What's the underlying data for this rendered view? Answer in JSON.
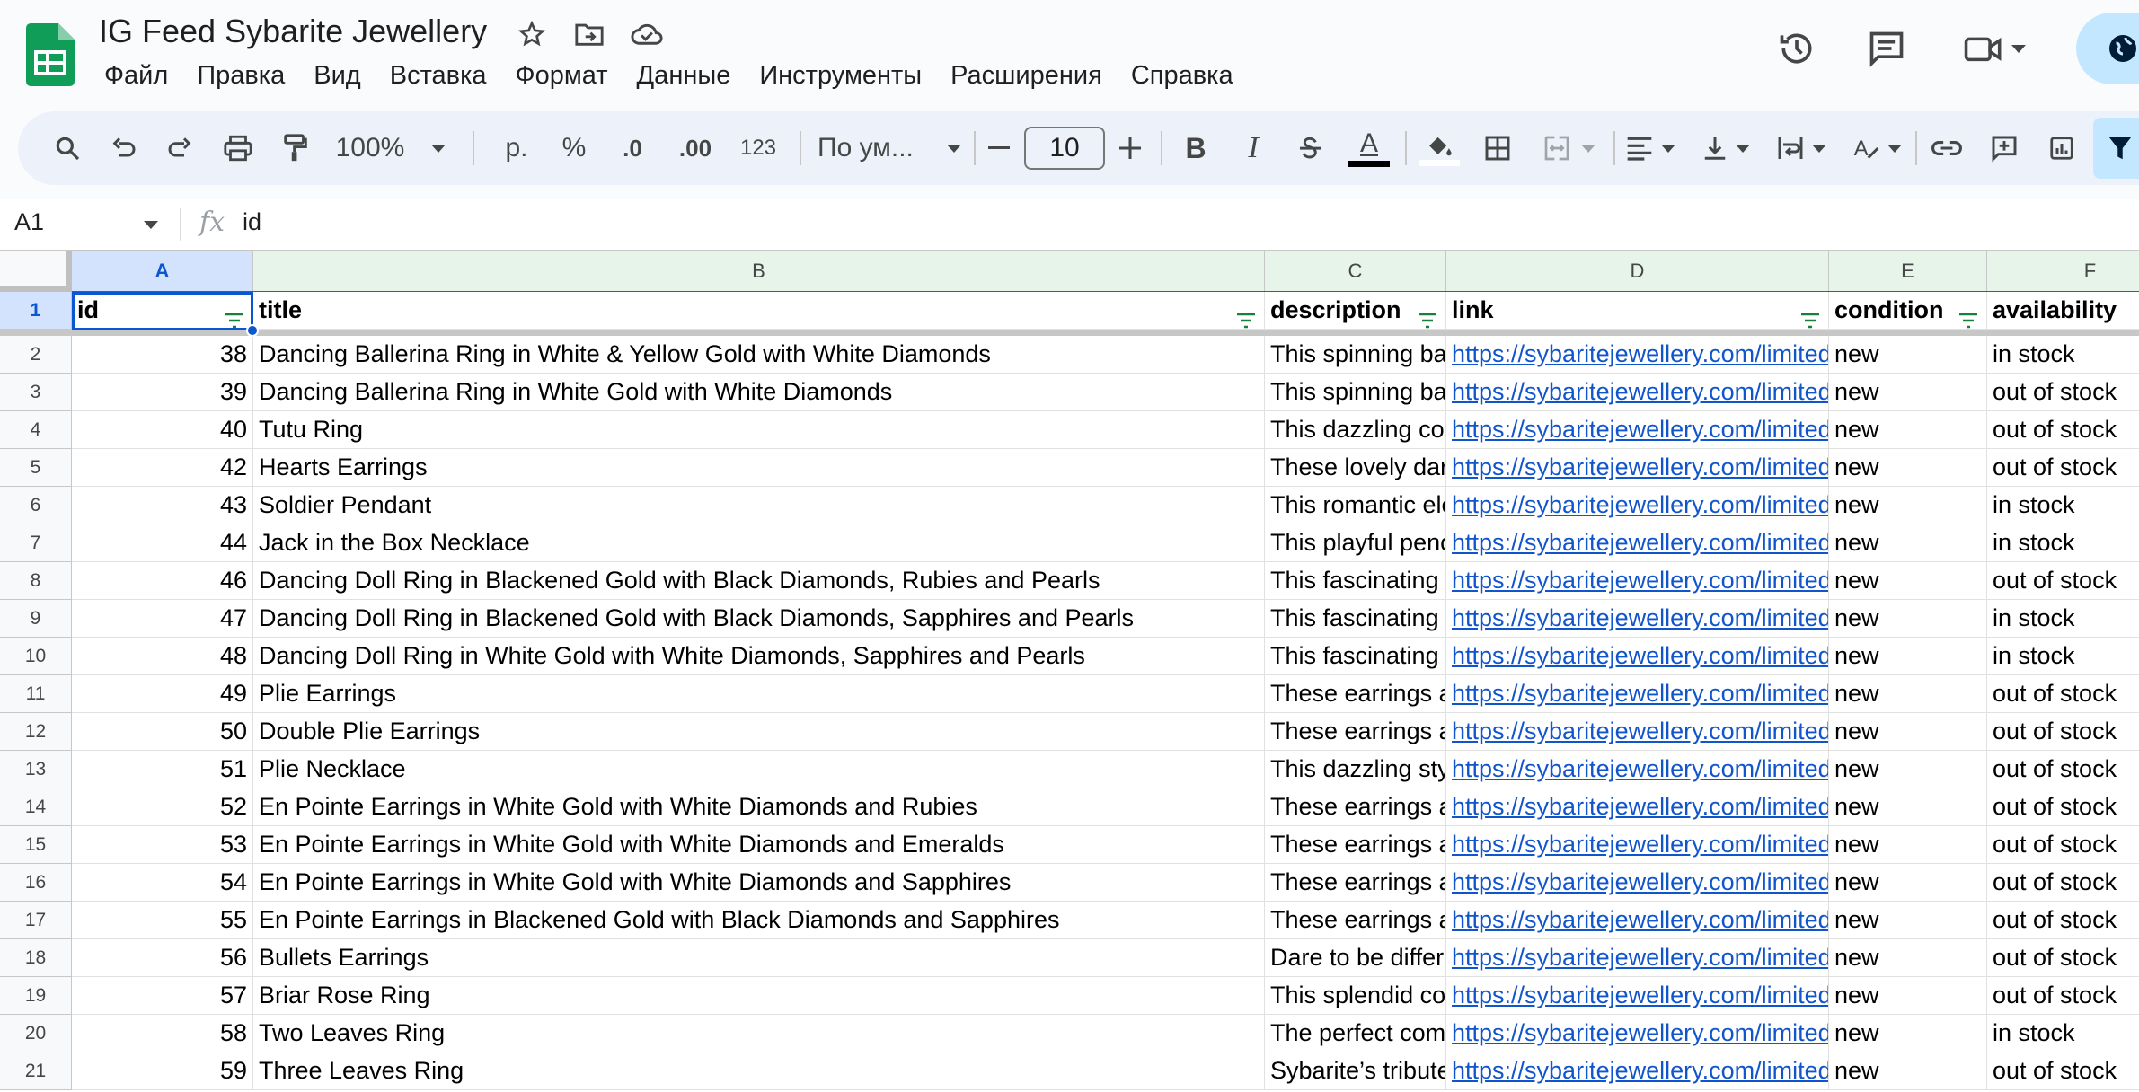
{
  "document": {
    "title": "IG Feed Sybarite Jewellery"
  },
  "menu": [
    "Файл",
    "Правка",
    "Вид",
    "Вставка",
    "Формат",
    "Данные",
    "Инструменты",
    "Расширения",
    "Справка"
  ],
  "toolbar": {
    "zoom": "100%",
    "currency": "р.",
    "percent": "%",
    "decrease_decimal": ".0",
    "increase_decimal": ".00",
    "number_format": "123",
    "font": "По ум...",
    "font_size": "10",
    "bold": "B",
    "italic": "I",
    "text_color_letter": "A",
    "text_color": "#000000"
  },
  "formula_bar": {
    "cell_ref": "A1",
    "fx": "fx",
    "value": "id"
  },
  "colors": {
    "accent": "#0b57d0",
    "link": "#1155cc",
    "filter_green": "#188038",
    "logo_green": "#0f9d58"
  },
  "grid": {
    "columns": [
      "A",
      "B",
      "C",
      "D",
      "E",
      "F"
    ],
    "headers": [
      "id",
      "title",
      "description",
      "link",
      "condition",
      "availability"
    ],
    "row_numbers": [
      "1",
      "2",
      "3",
      "4",
      "5",
      "6",
      "7",
      "8",
      "9",
      "10",
      "11",
      "12",
      "13",
      "14",
      "15",
      "16",
      "17",
      "18",
      "19",
      "20",
      "21"
    ],
    "rows": [
      [
        "38",
        "Dancing Ballerina Ring in White & Yellow Gold with White Diamonds",
        "This spinning ba",
        "https://sybaritejewellery.com/limited",
        "new",
        "in stock"
      ],
      [
        "39",
        "Dancing Ballerina Ring in White Gold with White Diamonds",
        "This spinning ba",
        "https://sybaritejewellery.com/limited",
        "new",
        "out of stock"
      ],
      [
        "40",
        "Tutu Ring",
        "This dazzling coc",
        "https://sybaritejewellery.com/limited",
        "new",
        "out of stock"
      ],
      [
        "42",
        "Hearts Earrings",
        "These lovely dar",
        "https://sybaritejewellery.com/limited",
        "new",
        "out of stock"
      ],
      [
        "43",
        "Soldier Pendant",
        "This romantic ele",
        "https://sybaritejewellery.com/limited",
        "new",
        "in stock"
      ],
      [
        "44",
        "Jack in the Box Necklace",
        "This playful penc",
        "https://sybaritejewellery.com/limited",
        "new",
        "in stock"
      ],
      [
        "46",
        "Dancing Doll Ring in Blackened Gold with Black Diamonds, Rubies and Pearls",
        "This fascinating",
        "https://sybaritejewellery.com/limited",
        "new",
        "out of stock"
      ],
      [
        "47",
        "Dancing Doll Ring in Blackened Gold with Black Diamonds, Sapphires and Pearls",
        "This fascinating",
        "https://sybaritejewellery.com/limited",
        "new",
        "in stock"
      ],
      [
        "48",
        "Dancing Doll Ring in White Gold with White Diamonds, Sapphires and Pearls",
        "This fascinating",
        "https://sybaritejewellery.com/limited",
        "new",
        "in stock"
      ],
      [
        "49",
        "Plie Earrings",
        "These earrings a",
        "https://sybaritejewellery.com/limited",
        "new",
        "out of stock"
      ],
      [
        "50",
        "Double Plie Earrings",
        "These earrings a",
        "https://sybaritejewellery.com/limited",
        "new",
        "out of stock"
      ],
      [
        "51",
        "Plie Necklace",
        "This dazzling sty",
        "https://sybaritejewellery.com/limited",
        "new",
        "out of stock"
      ],
      [
        "52",
        "En Pointe Earrings in White Gold with White Diamonds and Rubies",
        "These earrings a",
        "https://sybaritejewellery.com/limited",
        "new",
        "out of stock"
      ],
      [
        "53",
        "En Pointe Earrings in White Gold with White Diamonds and Emeralds",
        "These earrings a",
        "https://sybaritejewellery.com/limited",
        "new",
        "out of stock"
      ],
      [
        "54",
        "En Pointe Earrings in White Gold with White Diamonds and Sapphires",
        "These earrings a",
        "https://sybaritejewellery.com/limited",
        "new",
        "out of stock"
      ],
      [
        "55",
        "En Pointe Earrings in Blackened Gold with Black Diamonds and Sapphires",
        "These earrings a",
        "https://sybaritejewellery.com/limited",
        "new",
        "out of stock"
      ],
      [
        "56",
        "Bullets Earrings",
        "Dare to be differe",
        "https://sybaritejewellery.com/limited",
        "new",
        "out of stock"
      ],
      [
        "57",
        "Briar Rose Ring",
        "This splendid co",
        "https://sybaritejewellery.com/limited",
        "new",
        "out of stock"
      ],
      [
        "58",
        "Two Leaves Ring",
        "The perfect com",
        "https://sybaritejewellery.com/limited",
        "new",
        "in stock"
      ],
      [
        "59",
        "Three Leaves Ring",
        "Sybarite’s tribute",
        "https://sybaritejewellery.com/limited",
        "new",
        "out of stock"
      ]
    ]
  }
}
